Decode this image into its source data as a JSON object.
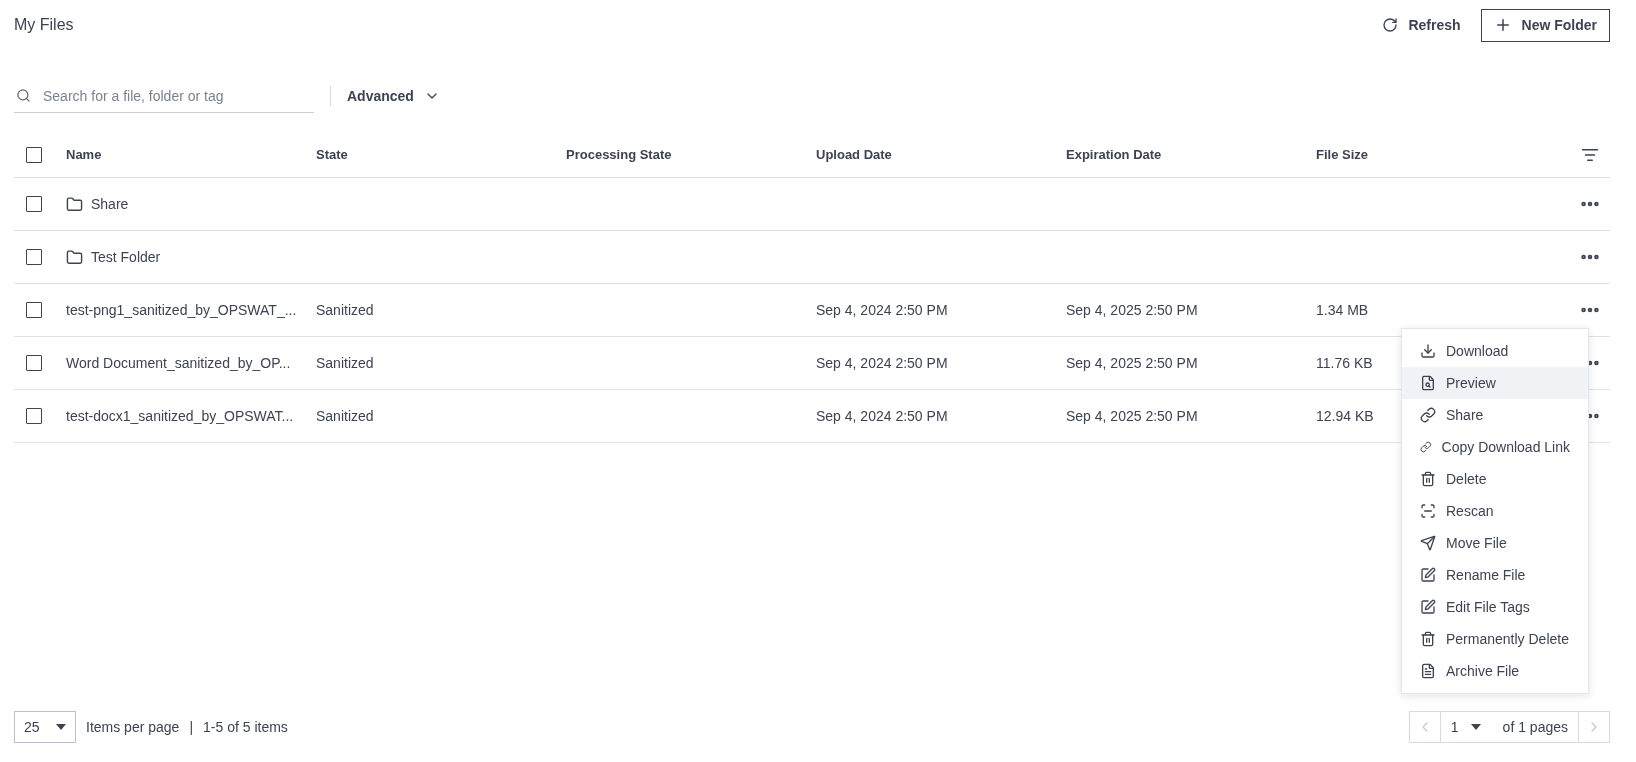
{
  "page_title": "My Files",
  "actions": [
    {
      "kind": "refresh",
      "label": "Refresh"
    },
    {
      "kind": "new",
      "label": "New Folder"
    }
  ],
  "search": {
    "placeholder": "Search for a file, folder or tag"
  },
  "advanced": {
    "label": "Advanced"
  },
  "table": {
    "select_all": {
      "checked": false
    },
    "columns": [
      "Name",
      "State",
      "Processing State",
      "Upload Date",
      "Expiration Date",
      "File Size"
    ],
    "rows": [
      {
        "kind": "folder",
        "checked": false,
        "cells": [
          "Share",
          "",
          "",
          "",
          "",
          ""
        ]
      },
      {
        "kind": "folder",
        "checked": false,
        "cells": [
          "Test Folder",
          "",
          "",
          "",
          "",
          ""
        ]
      },
      {
        "kind": "file",
        "checked": false,
        "cells": [
          "test-png1_sanitized_by_OPSWAT_...",
          "Sanitized",
          "",
          "Sep 4, 2024 2:50 PM",
          "Sep 4, 2025 2:50 PM",
          "1.34 MB"
        ]
      },
      {
        "kind": "file",
        "checked": false,
        "cells": [
          "Word Document_sanitized_by_OP...",
          "Sanitized",
          "",
          "Sep 4, 2024 2:50 PM",
          "Sep 4, 2025 2:50 PM",
          "11.76 KB"
        ]
      },
      {
        "kind": "file",
        "checked": false,
        "cells": [
          "test-docx1_sanitized_by_OPSWAT...",
          "Sanitized",
          "",
          "Sep 4, 2024 2:50 PM",
          "Sep 4, 2025 2:50 PM",
          "12.94 KB"
        ]
      }
    ]
  },
  "context_menu": {
    "items": [
      {
        "kind": "download",
        "label": "Download",
        "selected": false
      },
      {
        "kind": "preview",
        "label": "Preview",
        "selected": true
      },
      {
        "kind": "link",
        "label": "Share",
        "selected": false
      },
      {
        "kind": "link",
        "label": "Copy Download Link",
        "selected": false
      },
      {
        "kind": "delete",
        "label": "Delete",
        "selected": false
      },
      {
        "kind": "rescan",
        "label": "Rescan",
        "selected": false
      },
      {
        "kind": "move",
        "label": "Move File",
        "selected": false
      },
      {
        "kind": "edit",
        "label": "Rename File",
        "selected": false
      },
      {
        "kind": "edit",
        "label": "Edit File Tags",
        "selected": false
      },
      {
        "kind": "delete",
        "label": "Permanently Delete",
        "selected": false
      },
      {
        "kind": "archive",
        "label": "Archive File",
        "selected": false
      }
    ]
  },
  "footer": {
    "page_size": "25",
    "items_label": "Items per page",
    "separator": "|",
    "range": "1-5 of 5 items",
    "page": "1",
    "pages_label": "of 1 pages"
  }
}
